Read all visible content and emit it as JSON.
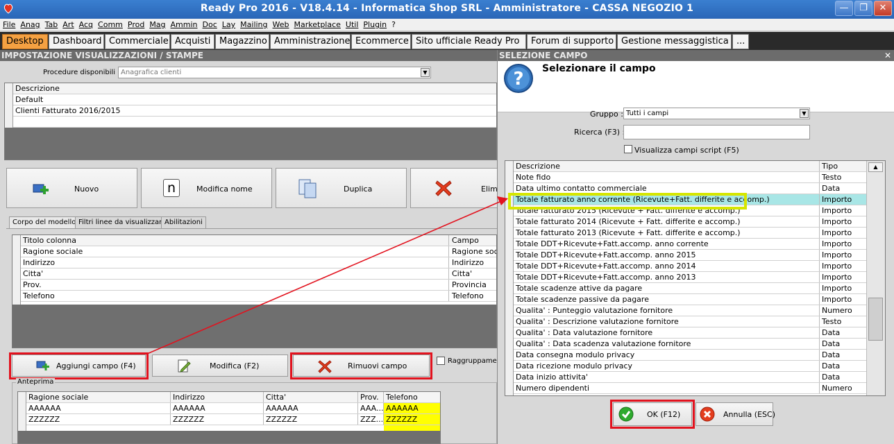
{
  "titlebar": {
    "title": "Ready Pro 2016 - V18.4.14 - Informatica Shop SRL - Amministratore - CASSA NEGOZIO 1"
  },
  "menu": [
    "File",
    "Anag",
    "Tab",
    "Art",
    "Acq",
    "Comm",
    "Prod",
    "Mag",
    "Ammin",
    "Doc",
    "Lay",
    "Mailing",
    "Web",
    "Marketplace",
    "Util",
    "Plugin",
    "?"
  ],
  "tabs": [
    "Desktop",
    "Dashboard",
    "Commerciale",
    "Acquisti",
    "Magazzino",
    "Amministrazione",
    "Ecommerce",
    "Sito ufficiale Ready Pro",
    "Forum di supporto",
    "Gestione messaggistica",
    "..."
  ],
  "left": {
    "section_title": "IMPOSTAZIONE VISUALIZZAZIONI / STAMPE",
    "procedure_label": "Procedure disponibili :",
    "procedure_value": "Anagrafica clienti",
    "models_header": "Descrizione",
    "models": [
      "Default",
      "Clienti Fatturato 2016/2015"
    ],
    "buttons": {
      "new": "Nuovo",
      "rename": "Modifica nome",
      "duplicate": "Duplica",
      "delete": "Elimi"
    },
    "subtabs": [
      "Corpo del modello",
      "Filtri linee da visualizzare",
      "Abilitazioni"
    ],
    "columns_header": {
      "title": "Titolo colonna",
      "field": "Campo"
    },
    "columns": [
      {
        "title": "Ragione sociale",
        "field": "Ragione soci"
      },
      {
        "title": "Indirizzo",
        "field": "Indirizzo"
      },
      {
        "title": "Citta'",
        "field": "Citta'"
      },
      {
        "title": "Prov.",
        "field": "Provincia"
      },
      {
        "title": "Telefono",
        "field": "Telefono"
      }
    ],
    "actions": {
      "add": "Aggiungi campo (F4)",
      "edit": "Modifica (F2)",
      "remove": "Rimuovi campo",
      "group": "Raggruppamen"
    },
    "preview_label": "Anteprima",
    "preview_headers": [
      "Ragione sociale",
      "Indirizzo",
      "Citta'",
      "Prov.",
      "Telefono"
    ],
    "preview_rows": [
      [
        "AAAAAA",
        "AAAAAA",
        "AAAAAA",
        "AAA...",
        "AAAAAA"
      ],
      [
        "ZZZZZZ",
        "ZZZZZZ",
        "ZZZZZZ",
        "ZZZ...",
        "ZZZZZZ"
      ]
    ]
  },
  "dialog": {
    "section_title": "SELEZIONE CAMPO",
    "heading": "Selezionare il campo",
    "group_label": "Gruppo :",
    "group_value": "Tutti i campi",
    "search_label": "Ricerca (F3) :",
    "search_value": "",
    "script_checkbox": "Visualizza campi script (F5)",
    "list_headers": {
      "desc": "Descrizione",
      "type": "Tipo"
    },
    "rows": [
      {
        "desc": "Note fido",
        "type": "Testo"
      },
      {
        "desc": "Data ultimo contatto commerciale",
        "type": "Data"
      },
      {
        "desc": "Totale fatturato anno corrente (Ricevute+Fatt. differite e accomp.)",
        "type": "Importo"
      },
      {
        "desc": "Totale fatturato 2015 (Ricevute + Fatt. differite e accomp.)",
        "type": "Importo"
      },
      {
        "desc": "Totale fatturato 2014 (Ricevute + Fatt. differite e accomp.)",
        "type": "Importo"
      },
      {
        "desc": "Totale fatturato 2013 (Ricevute + Fatt. differite e accomp.)",
        "type": "Importo"
      },
      {
        "desc": "Totale DDT+Ricevute+Fatt.accomp. anno corrente",
        "type": "Importo"
      },
      {
        "desc": "Totale DDT+Ricevute+Fatt.accomp. anno 2015",
        "type": "Importo"
      },
      {
        "desc": "Totale DDT+Ricevute+Fatt.accomp. anno 2014",
        "type": "Importo"
      },
      {
        "desc": "Totale DDT+Ricevute+Fatt.accomp. anno 2013",
        "type": "Importo"
      },
      {
        "desc": "Totale scadenze attive da pagare",
        "type": "Importo"
      },
      {
        "desc": "Totale scadenze passive da pagare",
        "type": "Importo"
      },
      {
        "desc": "Qualita' : Punteggio valutazione fornitore",
        "type": "Numero"
      },
      {
        "desc": "Qualita' : Descrizione valutazione fornitore",
        "type": "Testo"
      },
      {
        "desc": "Qualita' : Data valutazione fornitore",
        "type": "Data"
      },
      {
        "desc": "Qualita' : Data scadenza valutazione fornitore",
        "type": "Data"
      },
      {
        "desc": "Data consegna modulo privacy",
        "type": "Data"
      },
      {
        "desc": "Data ricezione modulo privacy",
        "type": "Data"
      },
      {
        "desc": "Data inizio attivita'",
        "type": "Data"
      },
      {
        "desc": "Numero dipendenti",
        "type": "Numero"
      }
    ],
    "ok": "OK (F12)",
    "cancel": "Annulla (ESC)"
  }
}
